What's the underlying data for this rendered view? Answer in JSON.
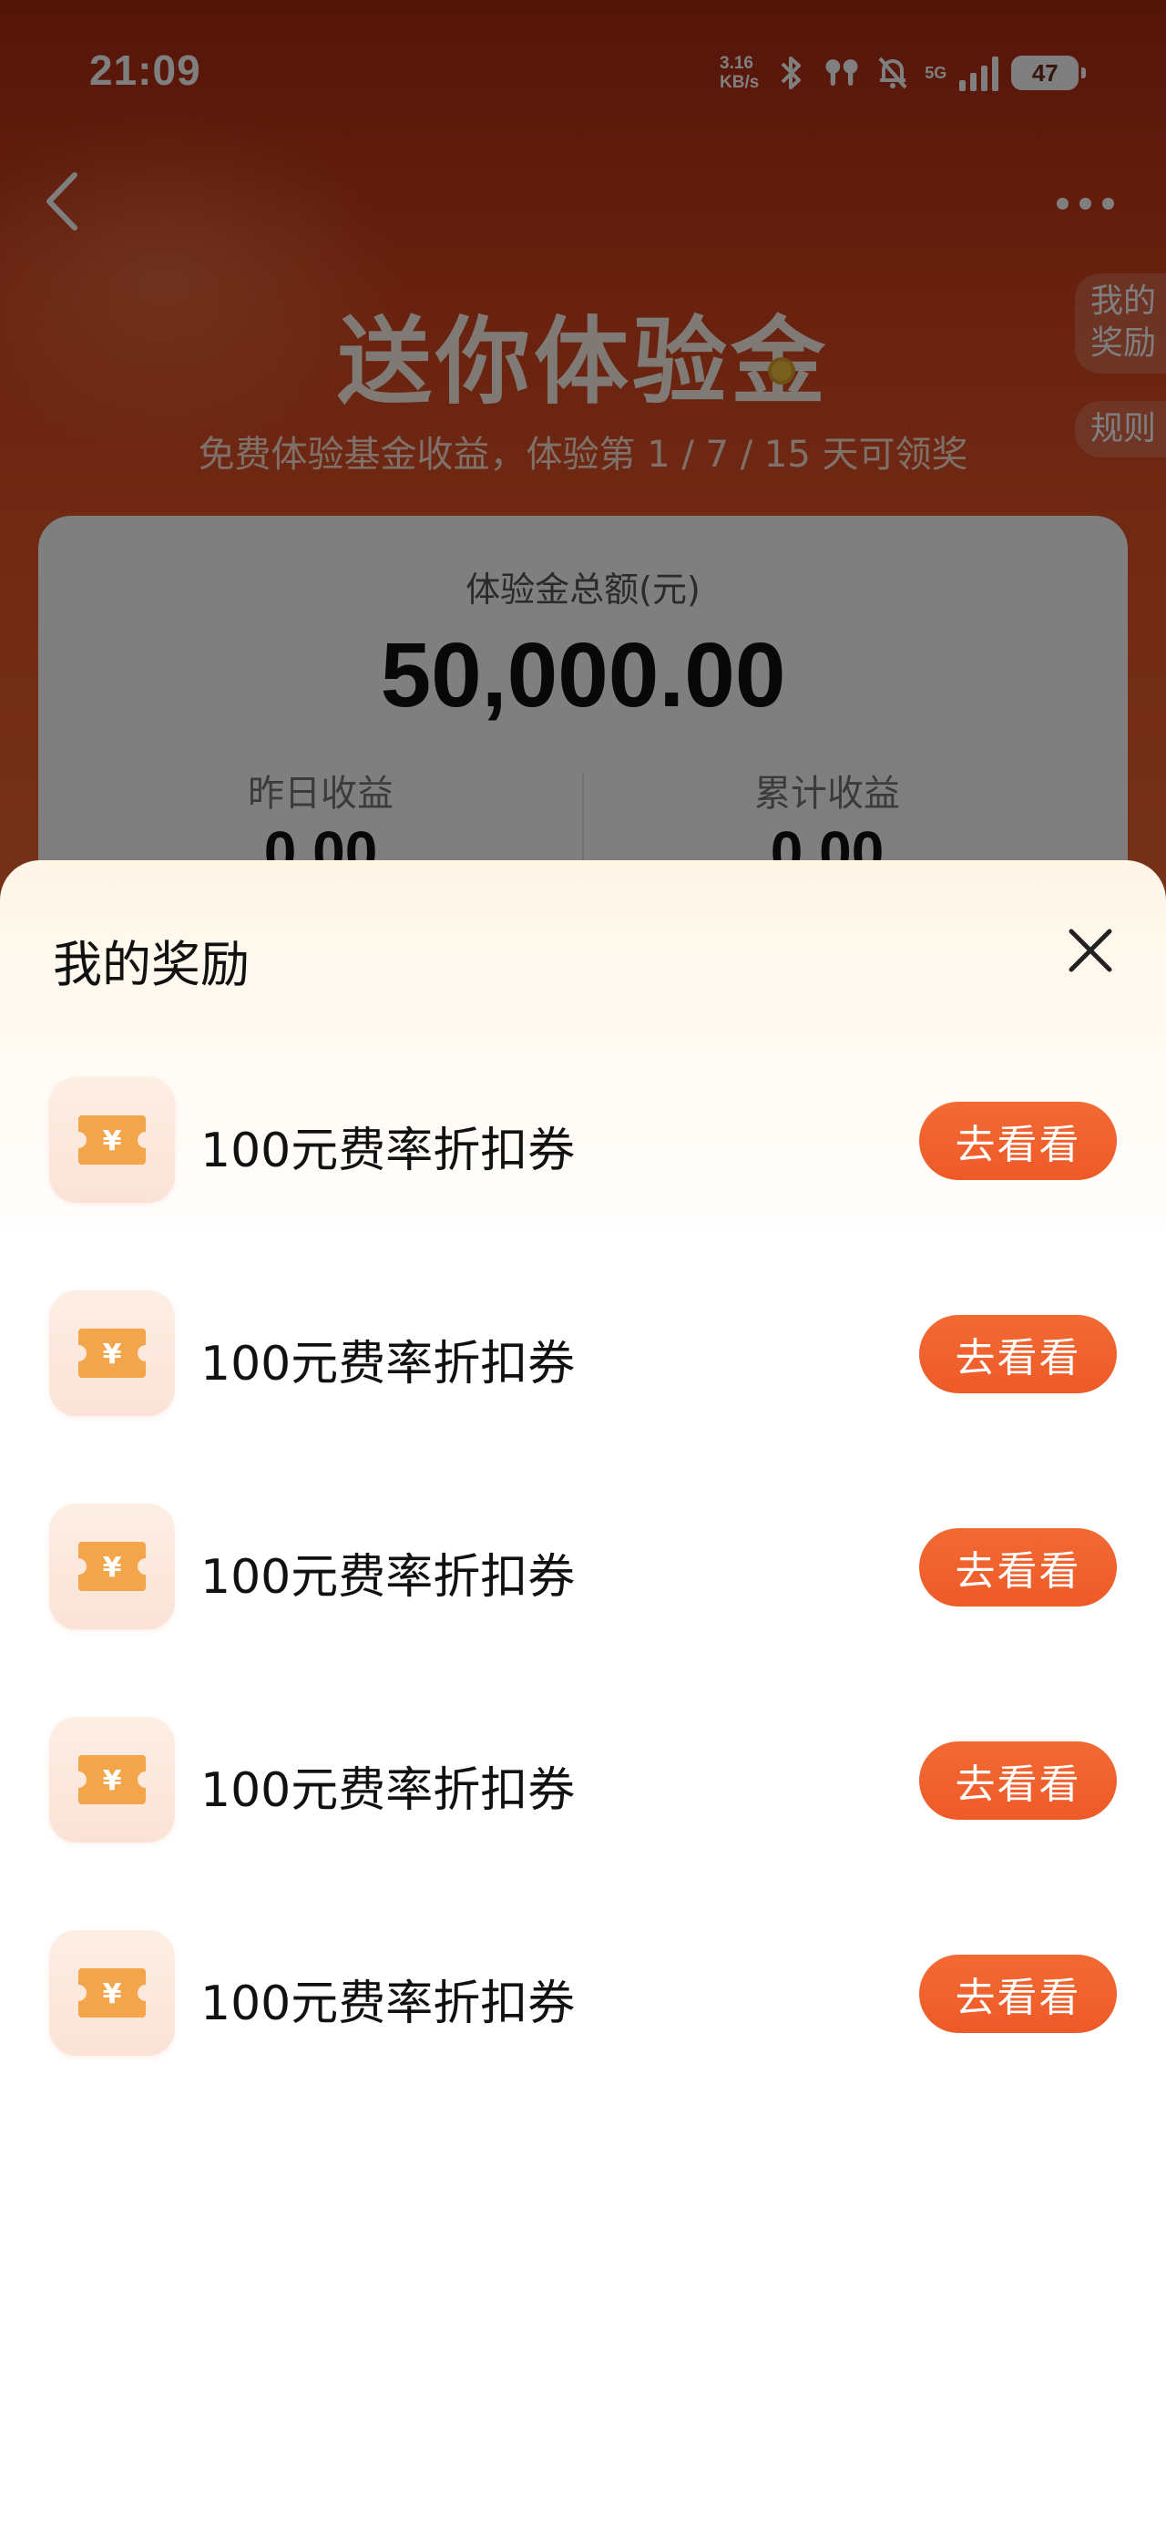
{
  "status_bar": {
    "time": "21:09",
    "net_speed_value": "3.16",
    "net_speed_unit": "KB/s",
    "network_type": "5G",
    "battery": "47"
  },
  "background": {
    "title": "送你体验金",
    "subtitle": "免费体验基金收益，体验第 1 / 7 / 15 天可领奖",
    "side_tabs": {
      "rewards": "我的\n奖励",
      "rules": "规则"
    },
    "card": {
      "label": "体验金总额(元)",
      "amount": "50,000.00",
      "yesterday_label": "昨日收益",
      "yesterday_value": "0.00",
      "total_label": "累计收益",
      "total_value": "0.00"
    }
  },
  "sheet": {
    "title": "我的奖励",
    "rewards": [
      {
        "name": "100元费率折扣券",
        "button": "去看看"
      },
      {
        "name": "100元费率折扣券",
        "button": "去看看"
      },
      {
        "name": "100元费率折扣券",
        "button": "去看看"
      },
      {
        "name": "100元费率折扣券",
        "button": "去看看"
      },
      {
        "name": "100元费率折扣券",
        "button": "去看看"
      }
    ]
  },
  "colors": {
    "accent": "#ee5a28",
    "header_gradient_top": "#a82a12",
    "coupon_icon": "#f3a54b"
  },
  "icons": {
    "back": "chevron-left-icon",
    "more": "more-dots-icon",
    "close": "close-icon",
    "coupon": "yen-coupon-icon"
  }
}
